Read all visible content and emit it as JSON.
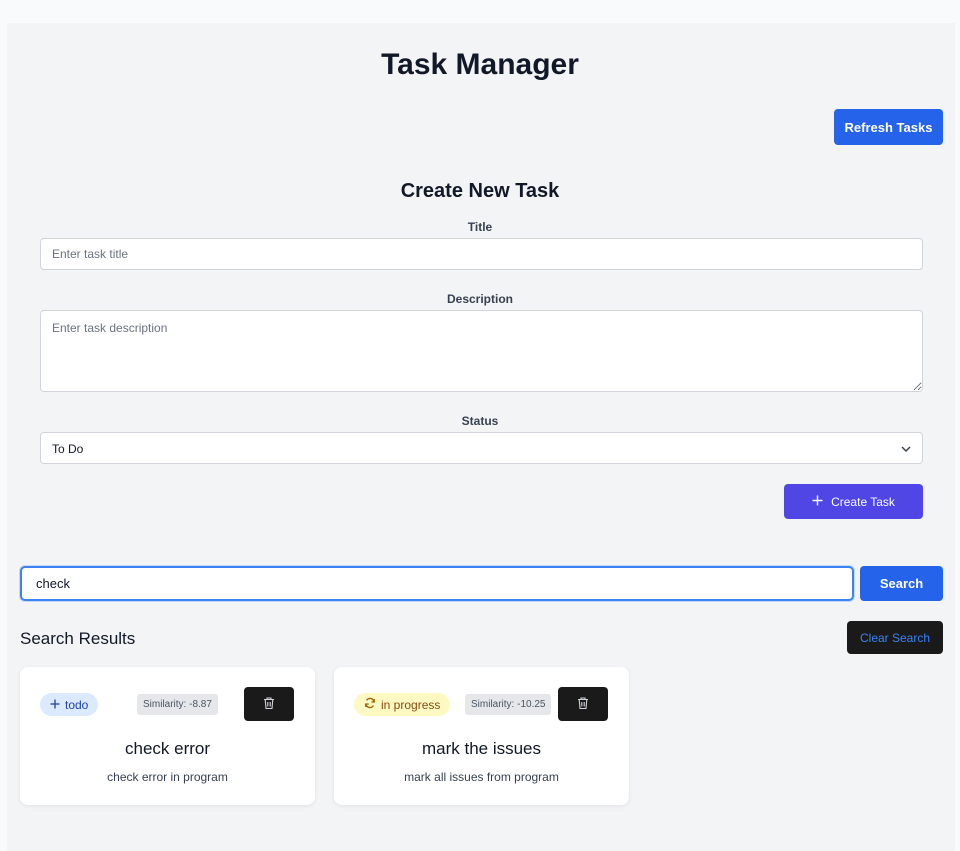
{
  "app": {
    "title": "Task Manager",
    "refresh_label": "Refresh Tasks"
  },
  "form": {
    "heading": "Create New Task",
    "title_label": "Title",
    "title_placeholder": "Enter task title",
    "title_value": "",
    "description_label": "Description",
    "description_placeholder": "Enter task description",
    "description_value": "",
    "status_label": "Status",
    "status_value": "To Do",
    "create_label": "Create Task"
  },
  "search": {
    "value": "check",
    "button_label": "Search"
  },
  "results": {
    "heading": "Search Results",
    "clear_label": "Clear Search",
    "tasks": [
      {
        "status": "todo",
        "status_icon": "plus-icon",
        "similarity": "Similarity: -8.87",
        "title": "check error",
        "description": "check error in program"
      },
      {
        "status": "in progress",
        "status_icon": "refresh-icon",
        "similarity": "Similarity: -10.25",
        "title": "mark the issues",
        "description": "mark all issues from program"
      }
    ]
  },
  "colors": {
    "primary": "#2563eb",
    "indigo": "#4f46e5",
    "todo_badge": "#dbeafe",
    "progress_badge": "#fef9c3",
    "dark_button": "#1a1a1a"
  }
}
